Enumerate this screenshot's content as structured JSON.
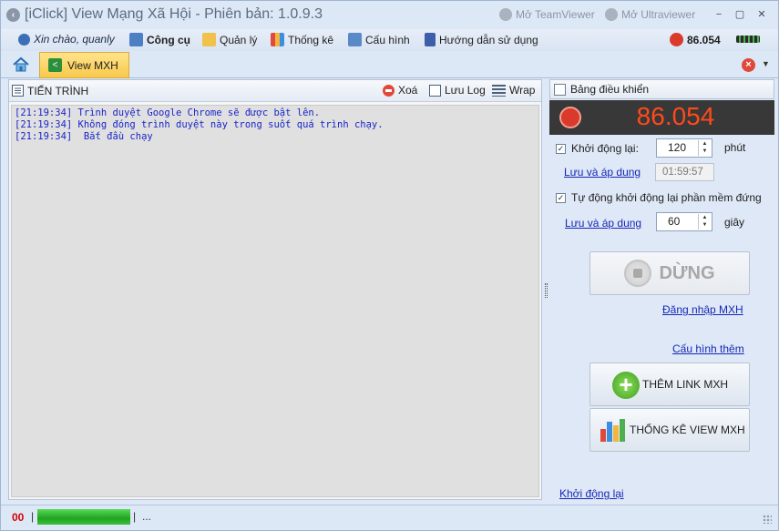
{
  "window": {
    "title": "[iClick] View Mạng Xã Hội - Phiên bản: 1.0.9.3",
    "teamviewer": "Mở TeamViewer",
    "ultraviewer": "Mở Ultraviewer",
    "buttons": [
      "−",
      "▢",
      "✕"
    ]
  },
  "menu": {
    "greeting": "Xin chào, quanly",
    "tools": "Công cụ",
    "manage": "Quản lý",
    "stats": "Thống kê",
    "config": "Cấu hình",
    "guide": "Hướng dẫn sử dụng",
    "balance": "86.054"
  },
  "tabs": {
    "active": "View MXH"
  },
  "progress_panel": {
    "title": "TIẾN TRÌNH",
    "clear": "Xoá",
    "save_log": "Lưu Log",
    "wrap": "Wrap",
    "log": [
      "[21:19:34] Trình duyệt Google Chrome sẽ được bật lên.",
      "[21:19:34] Không đóng trình duyệt này trong suốt quá trình chạy.",
      "[21:19:34]  Bắt đầu chạy"
    ]
  },
  "control_panel": {
    "title": "Bảng điều khiển",
    "counter": "86.054",
    "restart_label": "Khởi động lại:",
    "restart_value": "120",
    "restart_unit": "phút",
    "save_apply_1": "Lưu và áp dung",
    "countdown": "01:59:57",
    "auto_restart_label": "Tự động khởi động lại phần mềm đứng",
    "save_apply_2": "Lưu và áp dung",
    "auto_value": "60",
    "auto_unit": "giây",
    "stop_button": "DỪNG",
    "login_link": "Đăng nhập MXH",
    "more_config_link": "Cấu hình thêm",
    "add_link_button": "THÊM LINK MXH",
    "stats_button": "THỐNG KÊ VIEW MXH",
    "restart_link": "Khởi động lại"
  },
  "status": {
    "count": "00",
    "separator": "|",
    "extra": "..."
  },
  "colors": {
    "accent_tab": "#f8c94c",
    "counter_text": "#ff4a1a",
    "log_text": "#1a25c8",
    "link": "#1428b8"
  }
}
